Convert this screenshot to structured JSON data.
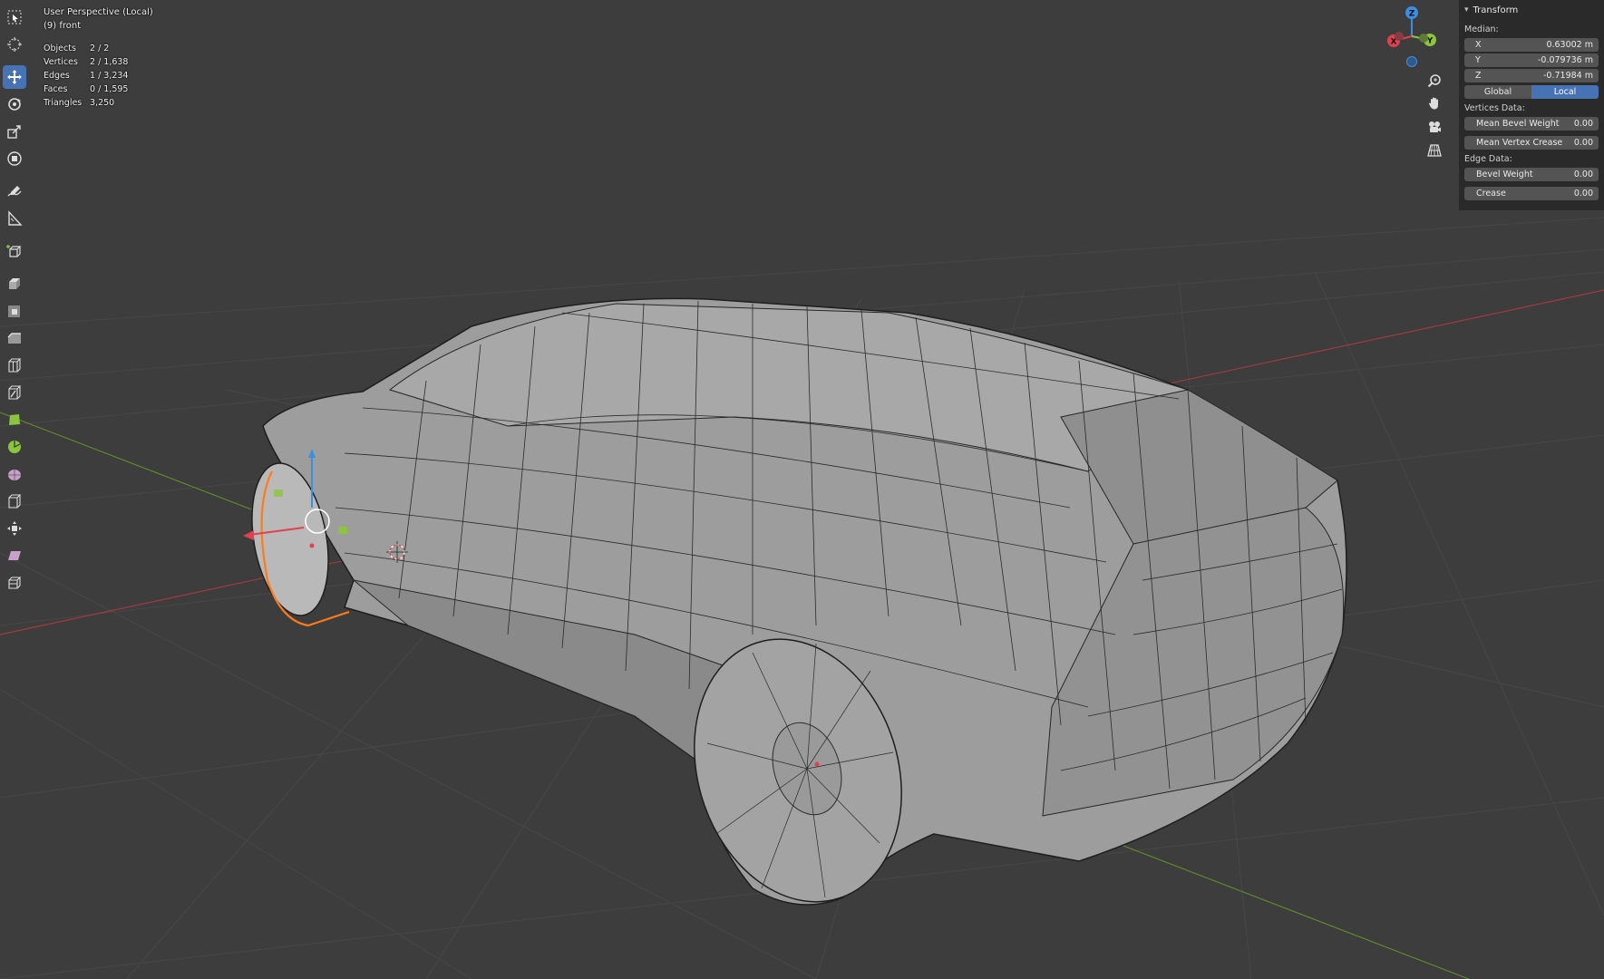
{
  "viewport": {
    "title": "User Perspective (Local)",
    "object_name": "(9) front",
    "stats": [
      {
        "label": "Objects",
        "value": "2 / 2"
      },
      {
        "label": "Vertices",
        "value": "2 / 1,638"
      },
      {
        "label": "Edges",
        "value": "1 / 3,234"
      },
      {
        "label": "Faces",
        "value": "0 / 1,595"
      },
      {
        "label": "Triangles",
        "value": "3,250"
      }
    ]
  },
  "gizmo": {
    "x": "X",
    "y": "Y",
    "z": "Z"
  },
  "panel": {
    "header": "Transform",
    "median_label": "Median:",
    "x_label": "X",
    "x_value": "0.63002 m",
    "y_label": "Y",
    "y_value": "-0.079736 m",
    "z_label": "Z",
    "z_value": "-0.71984 m",
    "global_label": "Global",
    "local_label": "Local",
    "vertices_data_label": "Vertices Data:",
    "mean_bevel_label": "Mean Bevel Weight",
    "mean_bevel_value": "0.00",
    "mean_crease_label": "Mean Vertex Crease",
    "mean_crease_value": "0.00",
    "edge_data_label": "Edge Data:",
    "bevel_weight_label": "Bevel Weight",
    "bevel_weight_value": "0.00",
    "crease_label": "Crease",
    "crease_value": "0.00"
  },
  "colors": {
    "background": "#3d3d3d",
    "active_tool": "#4772b3",
    "x_axis": "#e0414e",
    "y_axis": "#8bc53f",
    "z_axis": "#3d8ee0",
    "selection": "#ff7a1c"
  }
}
